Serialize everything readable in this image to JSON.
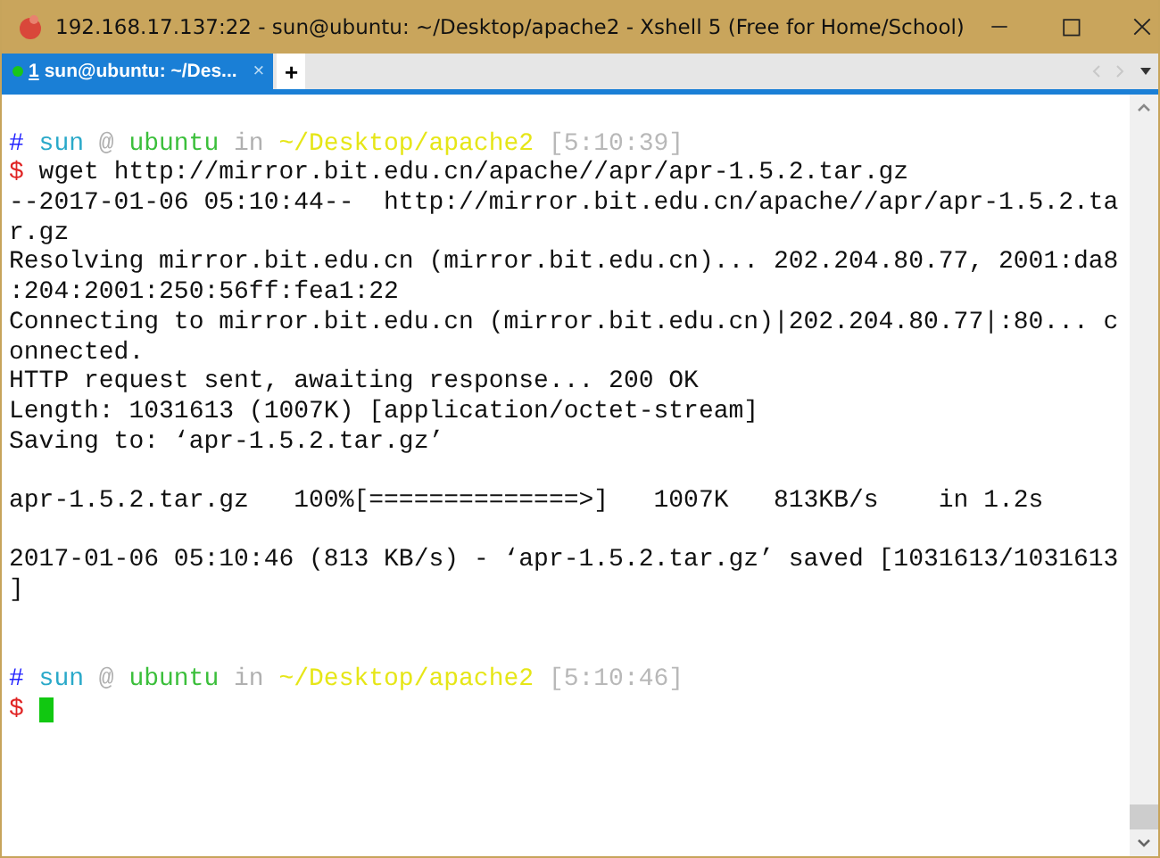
{
  "window": {
    "title": "192.168.17.137:22 - sun@ubuntu: ~/Desktop/apache2 - Xshell 5 (Free for Home/School)"
  },
  "tabs": [
    {
      "number": "1",
      "label": "sun@ubuntu: ~/Des...",
      "close": "×",
      "connected": true,
      "selected": true
    }
  ],
  "new_tab": "+",
  "terminal": {
    "lines": [
      {
        "kind": "blank"
      },
      {
        "kind": "prompt",
        "segments": [
          {
            "text": "#",
            "color": "#1f1fff"
          },
          {
            "text": "sun",
            "color": "#2aa9c9"
          },
          {
            "text": "@",
            "color": "#b0b0b0"
          },
          {
            "text": "ubuntu",
            "color": "#3bbf3b"
          },
          {
            "text": "in",
            "color": "#b0b0b0"
          },
          {
            "text": "~/Desktop/apache2",
            "color": "#e6e617"
          },
          {
            "text": "[5:10:39]",
            "color": "#b8b8b8"
          }
        ]
      },
      {
        "kind": "command",
        "symbol": "$",
        "text": "wget http://mirror.bit.edu.cn/apache//apr/apr-1.5.2.tar.gz"
      },
      {
        "kind": "output",
        "text": "--2017-01-06 05:10:44--  http://mirror.bit.edu.cn/apache//apr/apr-1.5.2.ta"
      },
      {
        "kind": "output",
        "text": "r.gz"
      },
      {
        "kind": "output",
        "text": "Resolving mirror.bit.edu.cn (mirror.bit.edu.cn)... 202.204.80.77, 2001:da8"
      },
      {
        "kind": "output",
        "text": ":204:2001:250:56ff:fea1:22"
      },
      {
        "kind": "output",
        "text": "Connecting to mirror.bit.edu.cn (mirror.bit.edu.cn)|202.204.80.77|:80... c"
      },
      {
        "kind": "output",
        "text": "onnected."
      },
      {
        "kind": "output",
        "text": "HTTP request sent, awaiting response... 200 OK"
      },
      {
        "kind": "output",
        "text": "Length: 1031613 (1007K) [application/octet-stream]"
      },
      {
        "kind": "output",
        "text": "Saving to: ‘apr-1.5.2.tar.gz’"
      },
      {
        "kind": "blank"
      },
      {
        "kind": "output",
        "text": "apr-1.5.2.tar.gz   100%[==============>]   1007K   813KB/s    in 1.2s"
      },
      {
        "kind": "blank"
      },
      {
        "kind": "output",
        "text": "2017-01-06 05:10:46 (813 KB/s) - ‘apr-1.5.2.tar.gz’ saved [1031613/1031613"
      },
      {
        "kind": "output",
        "text": "]"
      },
      {
        "kind": "blank"
      },
      {
        "kind": "blank"
      },
      {
        "kind": "prompt",
        "segments": [
          {
            "text": "#",
            "color": "#1f1fff"
          },
          {
            "text": "sun",
            "color": "#2aa9c9"
          },
          {
            "text": "@",
            "color": "#b0b0b0"
          },
          {
            "text": "ubuntu",
            "color": "#3bbf3b"
          },
          {
            "text": "in",
            "color": "#b0b0b0"
          },
          {
            "text": "~/Desktop/apache2",
            "color": "#e6e617"
          },
          {
            "text": "[5:10:46]",
            "color": "#b8b8b8"
          }
        ]
      },
      {
        "kind": "input",
        "symbol": "$",
        "cursor": true
      }
    ]
  }
}
